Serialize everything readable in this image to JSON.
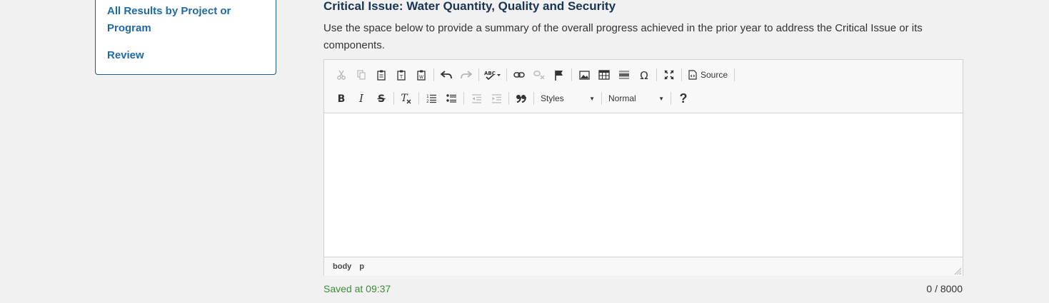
{
  "sidebar": {
    "items": [
      {
        "label": "All Results by Project or Program"
      },
      {
        "label": "Review"
      }
    ]
  },
  "main": {
    "title": "Critical Issue: Water Quantity, Quality and Security",
    "description": "Use the space below to provide a summary of the overall progress achieved in the prior year to address the Critical Issue or its components."
  },
  "editor": {
    "toolbar": {
      "source_label": "Source",
      "styles_label": "Styles",
      "format_label": "Normal",
      "help_label": "?"
    },
    "statusbar": {
      "path": [
        "body",
        "p"
      ]
    }
  },
  "footer": {
    "saved_text": "Saved at 09:37",
    "char_count": "0 / 8000"
  },
  "colors": {
    "link": "#1f6aa5",
    "title": "#1a3553",
    "saved": "#3c8a3c"
  }
}
